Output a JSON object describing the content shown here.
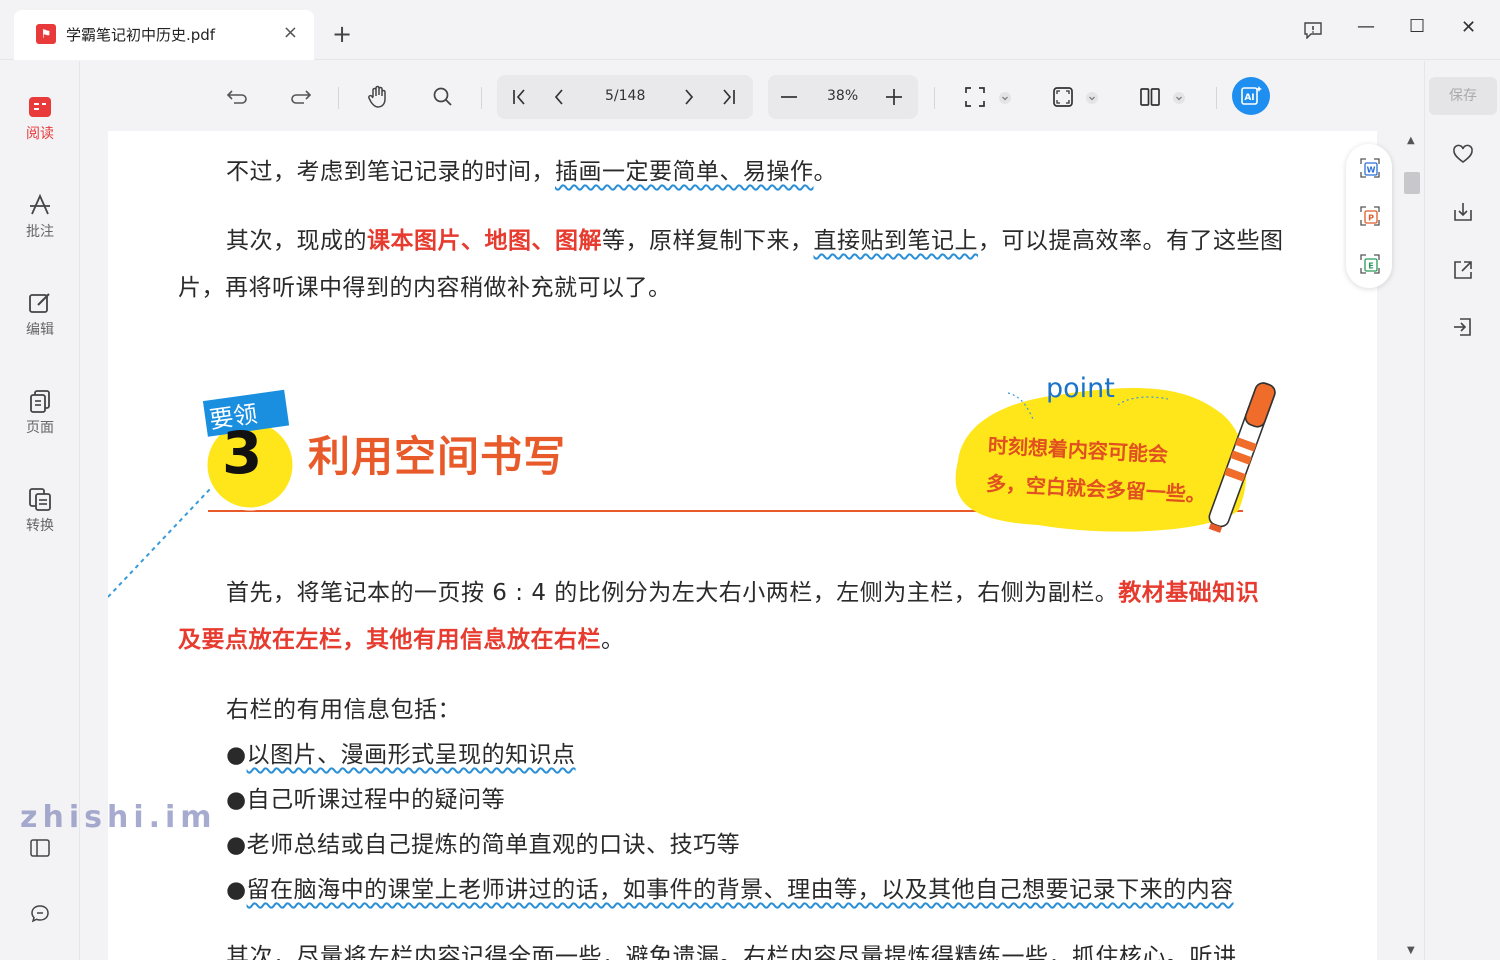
{
  "tab": {
    "title": "学霸笔记初中历史.pdf",
    "close_icon": "×"
  },
  "window": {
    "newtab": "+",
    "feedback_icon": "feedback-icon",
    "minimize": "—",
    "maximize": "☐",
    "close": "✕"
  },
  "leftnav": [
    {
      "label": "阅读",
      "icon": "book-icon",
      "active": true
    },
    {
      "label": "批注",
      "icon": "annotate-icon"
    },
    {
      "label": "编辑",
      "icon": "edit-icon"
    },
    {
      "label": "页面",
      "icon": "pages-icon"
    },
    {
      "label": "转换",
      "icon": "convert-icon"
    }
  ],
  "toolbar": {
    "page_indicator": "5/148",
    "zoom": "38%"
  },
  "rightrail": {
    "save_label": "保存"
  },
  "document": {
    "line1_pre": "不过，考虑到笔记记录的时间，",
    "line1_ul": "插画一定要简单、易操作",
    "line1_post": "。",
    "line2_pre": "其次，现成的",
    "line2_red": "课本图片、地图、图解",
    "line2_mid": "等，原样复制下来，",
    "line2_ul": "直接贴到笔记上",
    "line2_post": "，可以提高效率。有了这些图",
    "line3": "片，再将听课中得到的内容稍做补充就可以了。",
    "section_tag": "要领",
    "section_num": "3",
    "section_title": "利用空间书写",
    "point_word": "point",
    "point_line1": "时刻想着内容可能会",
    "point_line2": "多，空白就会多留一些。",
    "para1_a": "首先，将笔记本的一页按 6 : 4 的比例分为左大右小两栏，左侧为主栏，右侧为副栏。",
    "para1_red1": "教材基础知识",
    "para1_red2": "及要点放在左栏，其他有用信息放在右栏",
    "para1_end": "。",
    "list_intro": "右栏的有用信息包括：",
    "bullets": [
      "以图片、漫画形式呈现的知识点",
      "自己听课过程中的疑问等",
      "老师总结或自己提炼的简单直观的口诀、技巧等",
      "留在脑海中的课堂上老师讲过的话，如事件的背景、理由等，以及其他自己想要记录下来的内容"
    ],
    "last_line": "其次，尽量将左栏内容记得全面一些，避免遗漏。右栏内容尽量提炼得精练一些，抓住核心。听讲"
  },
  "watermark": "zhishi.im",
  "colors": {
    "accent_red": "#e8393b",
    "ai_blue": "#1e8ef0",
    "highlight_yellow": "#ffe61a",
    "link_blue": "#2a8fd6"
  }
}
